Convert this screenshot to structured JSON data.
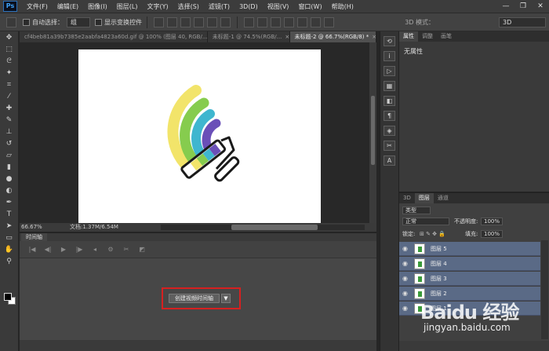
{
  "app": {
    "logo_text": "Ps"
  },
  "menu": {
    "items": [
      "文件(F)",
      "编辑(E)",
      "图像(I)",
      "图层(L)",
      "文字(Y)",
      "选择(S)",
      "滤镜(T)",
      "3D(D)",
      "视图(V)",
      "窗口(W)",
      "帮助(H)"
    ]
  },
  "window_controls": {
    "minimize": "—",
    "restore": "❐",
    "close": "✕"
  },
  "options": {
    "auto_select_label": "自动选择：",
    "auto_select_value": "组",
    "show_transform_label": "显示变换控件",
    "mode3d_label": "3D 模式：",
    "workspace_value": "3D"
  },
  "doc_tabs": [
    {
      "label": "cf4beb81a39b7385e2aabfa4823a60d.gif @ 100% (图层 40, RGB/...",
      "active": false
    },
    {
      "label": "未标题-1 @ 74.5%(RGB/...",
      "active": false
    },
    {
      "label": "未标题-2 @ 66.7%(RGB/8) *",
      "active": true
    }
  ],
  "status": {
    "zoom": "66.67%",
    "doc_info": "文档:1.37M/6.54M"
  },
  "timeline": {
    "tab_label": "时间轴",
    "create_button": "创建视频时间轴",
    "dropdown_glyph": "▼"
  },
  "properties_panel": {
    "tabs": [
      "属性",
      "调整",
      "画笔"
    ],
    "content": "无属性"
  },
  "layers_panel": {
    "tabs": [
      "3D",
      "图层",
      "通道"
    ],
    "filter_kind": "类型",
    "blend_mode": "正常",
    "opacity_label": "不透明度:",
    "opacity_value": "100%",
    "lock_label": "锁定:",
    "fill_label": "填充:",
    "fill_value": "100%",
    "layers": [
      "图层 5",
      "图层 4",
      "图层 3",
      "图层 2",
      "图层 1"
    ]
  },
  "watermark": {
    "brand": "Baidu 经验",
    "url": "jingyan.baidu.com"
  },
  "colors": {
    "yellow": "#f2e46a",
    "green": "#86cc4e",
    "blue": "#3fb6cf",
    "purple": "#6a4fb8",
    "selection_blue": "#5a6a86",
    "highlight_red": "#d62020"
  }
}
